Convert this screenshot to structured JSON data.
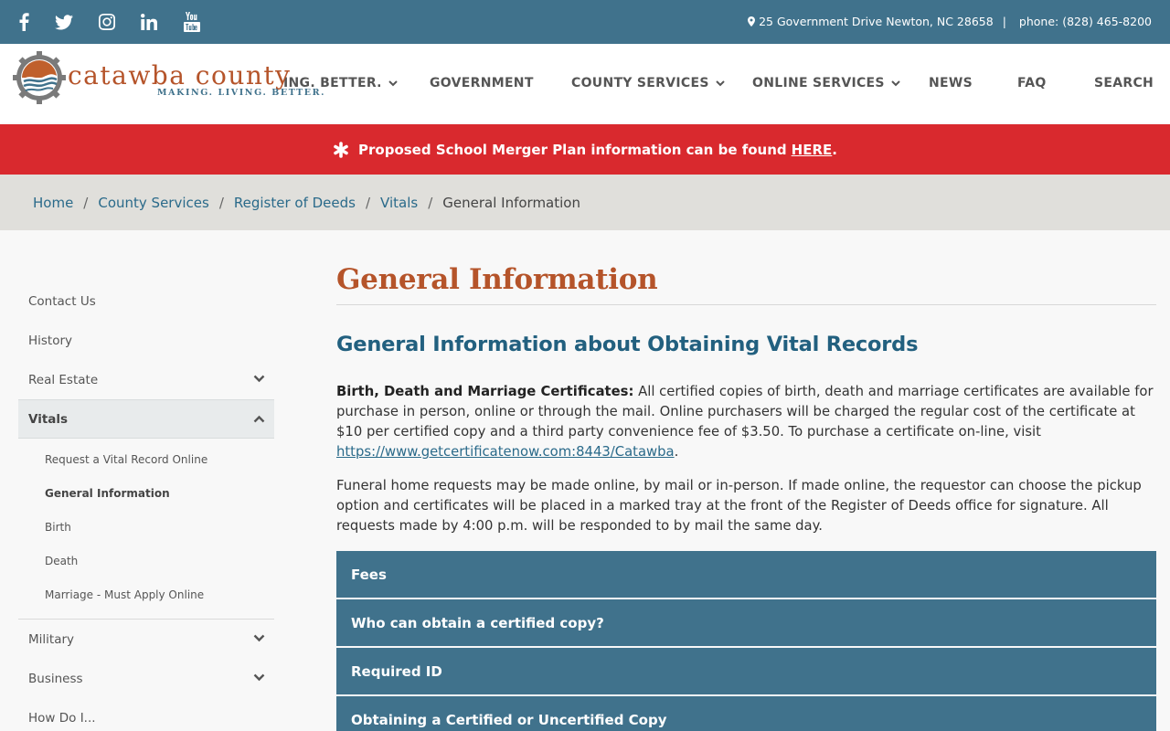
{
  "topbar": {
    "social": [
      {
        "name": "facebook-icon"
      },
      {
        "name": "twitter-icon"
      },
      {
        "name": "instagram-icon"
      },
      {
        "name": "linkedin-icon"
      },
      {
        "name": "youtube-icon"
      }
    ],
    "address": "25 Government Drive Newton, NC 28658",
    "separator": "|",
    "phone": "phone: (828) 465-8200"
  },
  "header": {
    "logo_text": "catawba county",
    "logo_tagline": "MAKING. LIVING. BETTER.",
    "nav": [
      {
        "label": "ING. BETTER.",
        "dropdown": true
      },
      {
        "label": "GOVERNMENT",
        "dropdown": false
      },
      {
        "label": "COUNTY SERVICES",
        "dropdown": true
      },
      {
        "label": "ONLINE SERVICES",
        "dropdown": true
      },
      {
        "label": "NEWS",
        "dropdown": false
      },
      {
        "label": "FAQ",
        "dropdown": false
      },
      {
        "label": "SEARCH",
        "dropdown": false
      }
    ]
  },
  "alert": {
    "text": "Proposed School Merger Plan information can be found",
    "link": "HERE",
    "suffix": "."
  },
  "breadcrumb": {
    "items": [
      "Home",
      "County Services",
      "Register of Deeds",
      "Vitals"
    ],
    "separator": "/",
    "current": "General Information"
  },
  "sidebar": {
    "items": [
      {
        "label": "Contact Us"
      },
      {
        "label": "History"
      },
      {
        "label": "Real Estate",
        "toggle": "down"
      },
      {
        "label": "Vitals",
        "toggle": "up",
        "active": true
      },
      {
        "label": "Military",
        "toggle": "down"
      },
      {
        "label": "Business",
        "toggle": "down"
      },
      {
        "label": "How Do I..."
      }
    ],
    "sub_items": [
      {
        "label": "Request a Vital Record Online"
      },
      {
        "label": "General Information",
        "current": true
      },
      {
        "label": "Birth"
      },
      {
        "label": "Death"
      },
      {
        "label": "Marriage - Must Apply Online"
      }
    ]
  },
  "main": {
    "title": "General Information",
    "section_title": "General Information about Obtaining Vital Records",
    "para1_bold": "Birth, Death and Marriage Certificates:",
    "para1_text": " All certified copies of birth, death and marriage certificates are available for purchase in person, online or through the mail. Online purchasers will be charged the regular cost of the certificate at $10 per certified copy and a third party convenience fee of $3.50. To purchase a certificate on-line, visit ",
    "para1_link": "https://www.getcertificatenow.com:8443/Catawba",
    "para1_end": ".",
    "para2": "Funeral home requests may be made online, by mail or in-person. If made online, the requestor can choose the pickup option and certificates will be placed in a marked tray at the front of the Register of Deeds office for signature. All requests made by 4:00 p.m. will be responded to by mail the same day.",
    "accordion": [
      {
        "label": "Fees"
      },
      {
        "label": "Who can obtain a certified copy?"
      },
      {
        "label": "Required ID"
      },
      {
        "label": "Obtaining a Certified or Uncertified Copy"
      }
    ]
  },
  "colors": {
    "topbar": "#40728c",
    "brand_orange": "#b5542a",
    "alert_red": "#d9292e",
    "link_blue": "#2a6a8a"
  }
}
